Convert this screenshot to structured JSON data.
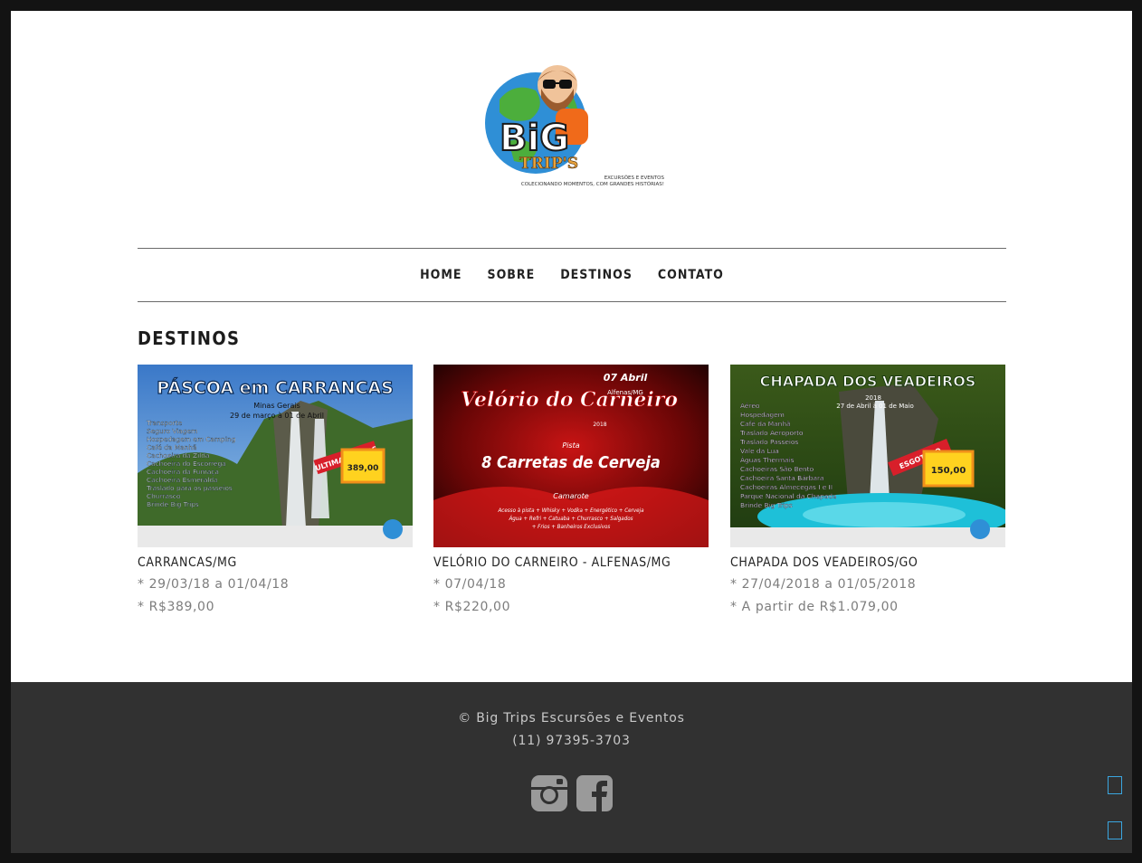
{
  "brand": {
    "logo_name": "BiG",
    "logo_sub": "TRIP'S",
    "tag1": "EXCURSÕES E EVENTOS",
    "tag2": "COLECIONANDO MOMENTOS, COM GRANDES HISTÓRIAS!"
  },
  "nav": {
    "items": [
      {
        "label": "HOME"
      },
      {
        "label": "SOBRE"
      },
      {
        "label": "DESTINOS"
      },
      {
        "label": "CONTATO"
      }
    ]
  },
  "page": {
    "title": "DESTINOS"
  },
  "destinations": [
    {
      "name": "CARRANCAS/MG",
      "dates": "* 29/03/18 a 01/04/18",
      "price": "* R$389,00",
      "poster": {
        "title": "PÁSCOA em CARRANCAS",
        "subtitle": "Minas Gerais",
        "dates": "29 de março à 01 de Abril",
        "items": [
          "Transporte",
          "Seguro Viagem",
          "Hospedagem em Camping",
          "Café da Manhã",
          "Cachoeira da Zilda",
          "Cachoeira do Escorrega",
          "Cachoeira da Fumaça",
          "Cachoeira Esmeralda",
          "Traslado para os passeios",
          "Churrasco",
          "Brinde Big Trips"
        ],
        "badge": "ULTIMAS VAGAS",
        "price": "389,00"
      }
    },
    {
      "name": "VELÓRIO DO CARNEIRO - ALFENAS/MG",
      "dates": "* 07/04/18",
      "price": "* R$220,00",
      "poster": {
        "title": "Velório do Carneiro",
        "date": "07 Abril",
        "year": "2018",
        "place": "Alfenas/MG",
        "pista": "Pista",
        "headline": "8 Carretas de Cerveja",
        "camarote": "Camarote",
        "line1": "Acesso à pista + Whisky + Vodka + Energético + Cerveja",
        "line2": "Água + Refri + Catuaba + Churrasco + Salgados",
        "line3": "+ Frios + Banheiros Exclusivos"
      }
    },
    {
      "name": "CHAPADA DOS VEADEIROS/GO",
      "dates": "* 27/04/2018 a 01/05/2018",
      "price": "* A partir de R$1.079,00",
      "poster": {
        "title": "CHAPADA DOS VEADEIROS",
        "year": "2018",
        "dates": "27 de Abril à 01 de Maio",
        "items": [
          "Aéreo",
          "Hospedagem",
          "Café da Manhã",
          "Traslado Aeroporto",
          "Traslado Passeios",
          "Vale da Lua",
          "Águas Thermais",
          "Cachoeiras São Bento",
          "Cachoeira Santa Bárbara",
          "Cachoeiras Almecegas I e II",
          "Parque Nacional da Chapada",
          "Brinde Big Trips"
        ],
        "badge": "ESGOTADO",
        "price": "150,00"
      }
    }
  ],
  "footer": {
    "copyright": "© Big Trips Escursões e Eventos",
    "phone": "(11) 97395-3703"
  },
  "colors": {
    "page_bg": "#ffffff",
    "frame": "#131313",
    "footer_bg": "#313131",
    "accent_side_icons": "#3aa6e0"
  },
  "icons": [
    "instagram-icon",
    "facebook-icon"
  ]
}
